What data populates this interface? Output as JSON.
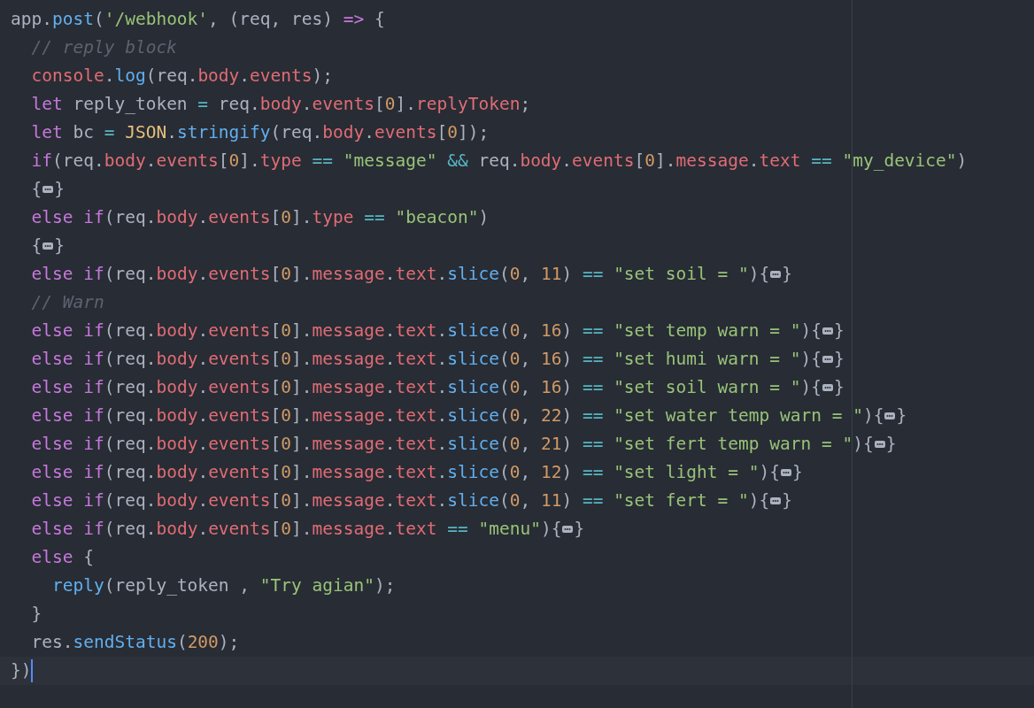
{
  "editor": {
    "lines": [
      {
        "tokens": [
          {
            "kind": "plain",
            "text": "app."
          },
          {
            "kind": "function",
            "text": "post"
          },
          {
            "kind": "plain",
            "text": "("
          },
          {
            "kind": "string",
            "text": "'/webhook'"
          },
          {
            "kind": "plain",
            "text": ", (req, res)"
          },
          {
            "kind": "keyword",
            "text": " =>"
          },
          {
            "kind": "plain",
            "text": " {"
          }
        ],
        "children": [
          {
            "tokens": [
              {
                "kind": "comment",
                "text": "// reply block"
              }
            ]
          },
          {
            "tokens": [
              {
                "kind": "property",
                "text": "console"
              },
              {
                "kind": "plain",
                "text": "."
              },
              {
                "kind": "function",
                "text": "log"
              },
              {
                "kind": "plain",
                "text": "(req."
              },
              {
                "kind": "property",
                "text": "body"
              },
              {
                "kind": "plain",
                "text": "."
              },
              {
                "kind": "property",
                "text": "events"
              },
              {
                "kind": "plain",
                "text": ");"
              }
            ]
          },
          {
            "tokens": [
              {
                "kind": "keyword",
                "text": "let"
              },
              {
                "kind": "plain",
                "text": " reply_token"
              },
              {
                "kind": "operator",
                "text": " ="
              },
              {
                "kind": "plain",
                "text": " req."
              },
              {
                "kind": "property",
                "text": "body"
              },
              {
                "kind": "plain",
                "text": "."
              },
              {
                "kind": "property",
                "text": "events"
              },
              {
                "kind": "plain",
                "text": "["
              },
              {
                "kind": "number",
                "text": "0"
              },
              {
                "kind": "plain",
                "text": "]."
              },
              {
                "kind": "property",
                "text": "replyToken"
              },
              {
                "kind": "plain",
                "text": ";"
              }
            ]
          },
          {
            "tokens": [
              {
                "kind": "keyword",
                "text": "let"
              },
              {
                "kind": "plain",
                "text": " bc"
              },
              {
                "kind": "operator",
                "text": " ="
              },
              {
                "kind": "class",
                "text": " JSON"
              },
              {
                "kind": "plain",
                "text": "."
              },
              {
                "kind": "function",
                "text": "stringify"
              },
              {
                "kind": "plain",
                "text": "(req."
              },
              {
                "kind": "property",
                "text": "body"
              },
              {
                "kind": "plain",
                "text": "."
              },
              {
                "kind": "property",
                "text": "events"
              },
              {
                "kind": "plain",
                "text": "["
              },
              {
                "kind": "number",
                "text": "0"
              },
              {
                "kind": "plain",
                "text": "]);"
              }
            ]
          },
          {
            "tokens": [
              {
                "kind": "keyword",
                "text": "if"
              },
              {
                "kind": "plain",
                "text": "(req."
              },
              {
                "kind": "property",
                "text": "body"
              },
              {
                "kind": "plain",
                "text": "."
              },
              {
                "kind": "property",
                "text": "events"
              },
              {
                "kind": "plain",
                "text": "["
              },
              {
                "kind": "number",
                "text": "0"
              },
              {
                "kind": "plain",
                "text": "]."
              },
              {
                "kind": "property",
                "text": "type"
              },
              {
                "kind": "operator",
                "text": " =="
              },
              {
                "kind": "string",
                "text": " \"message\""
              },
              {
                "kind": "operator",
                "text": " &&"
              },
              {
                "kind": "plain",
                "text": " req."
              },
              {
                "kind": "property",
                "text": "body"
              },
              {
                "kind": "plain",
                "text": "."
              },
              {
                "kind": "property",
                "text": "events"
              },
              {
                "kind": "plain",
                "text": "["
              },
              {
                "kind": "number",
                "text": "0"
              },
              {
                "kind": "plain",
                "text": "]."
              },
              {
                "kind": "property",
                "text": "message"
              },
              {
                "kind": "plain",
                "text": "."
              },
              {
                "kind": "property",
                "text": "text"
              },
              {
                "kind": "operator",
                "text": " =="
              },
              {
                "kind": "string",
                "text": " \"my_device\""
              },
              {
                "kind": "plain",
                "text": ")"
              }
            ]
          },
          {
            "tokens": [
              {
                "kind": "plain",
                "text": "{"
              },
              {
                "kind": "fold"
              },
              {
                "kind": "plain",
                "text": "}"
              }
            ]
          },
          {
            "tokens": [
              {
                "kind": "keyword",
                "text": "else"
              },
              {
                "kind": "keyword",
                "text": " if"
              },
              {
                "kind": "plain",
                "text": "(req."
              },
              {
                "kind": "property",
                "text": "body"
              },
              {
                "kind": "plain",
                "text": "."
              },
              {
                "kind": "property",
                "text": "events"
              },
              {
                "kind": "plain",
                "text": "["
              },
              {
                "kind": "number",
                "text": "0"
              },
              {
                "kind": "plain",
                "text": "]."
              },
              {
                "kind": "property",
                "text": "type"
              },
              {
                "kind": "operator",
                "text": " =="
              },
              {
                "kind": "string",
                "text": " \"beacon\""
              },
              {
                "kind": "plain",
                "text": ")"
              }
            ]
          },
          {
            "tokens": [
              {
                "kind": "plain",
                "text": "{"
              },
              {
                "kind": "fold"
              },
              {
                "kind": "plain",
                "text": "}"
              }
            ]
          },
          {
            "tokens": [
              {
                "kind": "keyword",
                "text": "else"
              },
              {
                "kind": "keyword",
                "text": " if"
              },
              {
                "kind": "plain",
                "text": "(req."
              },
              {
                "kind": "property",
                "text": "body"
              },
              {
                "kind": "plain",
                "text": "."
              },
              {
                "kind": "property",
                "text": "events"
              },
              {
                "kind": "plain",
                "text": "["
              },
              {
                "kind": "number",
                "text": "0"
              },
              {
                "kind": "plain",
                "text": "]."
              },
              {
                "kind": "property",
                "text": "message"
              },
              {
                "kind": "plain",
                "text": "."
              },
              {
                "kind": "property",
                "text": "text"
              },
              {
                "kind": "plain",
                "text": "."
              },
              {
                "kind": "function",
                "text": "slice"
              },
              {
                "kind": "plain",
                "text": "("
              },
              {
                "kind": "number",
                "text": "0"
              },
              {
                "kind": "plain",
                "text": ","
              },
              {
                "kind": "number",
                "text": " 11"
              },
              {
                "kind": "plain",
                "text": ")"
              },
              {
                "kind": "operator",
                "text": " =="
              },
              {
                "kind": "string",
                "text": " \"set soil = \""
              },
              {
                "kind": "plain",
                "text": "){"
              },
              {
                "kind": "fold"
              },
              {
                "kind": "plain",
                "text": "}"
              }
            ]
          },
          {
            "tokens": [
              {
                "kind": "comment",
                "text": "// Warn"
              }
            ]
          },
          {
            "tokens": [
              {
                "kind": "keyword",
                "text": "else"
              },
              {
                "kind": "keyword",
                "text": " if"
              },
              {
                "kind": "plain",
                "text": "(req."
              },
              {
                "kind": "property",
                "text": "body"
              },
              {
                "kind": "plain",
                "text": "."
              },
              {
                "kind": "property",
                "text": "events"
              },
              {
                "kind": "plain",
                "text": "["
              },
              {
                "kind": "number",
                "text": "0"
              },
              {
                "kind": "plain",
                "text": "]."
              },
              {
                "kind": "property",
                "text": "message"
              },
              {
                "kind": "plain",
                "text": "."
              },
              {
                "kind": "property",
                "text": "text"
              },
              {
                "kind": "plain",
                "text": "."
              },
              {
                "kind": "function",
                "text": "slice"
              },
              {
                "kind": "plain",
                "text": "("
              },
              {
                "kind": "number",
                "text": "0"
              },
              {
                "kind": "plain",
                "text": ","
              },
              {
                "kind": "number",
                "text": " 16"
              },
              {
                "kind": "plain",
                "text": ")"
              },
              {
                "kind": "operator",
                "text": " =="
              },
              {
                "kind": "string",
                "text": " \"set temp warn = \""
              },
              {
                "kind": "plain",
                "text": "){"
              },
              {
                "kind": "fold"
              },
              {
                "kind": "plain",
                "text": "}"
              }
            ]
          },
          {
            "tokens": [
              {
                "kind": "keyword",
                "text": "else"
              },
              {
                "kind": "keyword",
                "text": " if"
              },
              {
                "kind": "plain",
                "text": "(req."
              },
              {
                "kind": "property",
                "text": "body"
              },
              {
                "kind": "plain",
                "text": "."
              },
              {
                "kind": "property",
                "text": "events"
              },
              {
                "kind": "plain",
                "text": "["
              },
              {
                "kind": "number",
                "text": "0"
              },
              {
                "kind": "plain",
                "text": "]."
              },
              {
                "kind": "property",
                "text": "message"
              },
              {
                "kind": "plain",
                "text": "."
              },
              {
                "kind": "property",
                "text": "text"
              },
              {
                "kind": "plain",
                "text": "."
              },
              {
                "kind": "function",
                "text": "slice"
              },
              {
                "kind": "plain",
                "text": "("
              },
              {
                "kind": "number",
                "text": "0"
              },
              {
                "kind": "plain",
                "text": ","
              },
              {
                "kind": "number",
                "text": " 16"
              },
              {
                "kind": "plain",
                "text": ")"
              },
              {
                "kind": "operator",
                "text": " =="
              },
              {
                "kind": "string",
                "text": " \"set humi warn = \""
              },
              {
                "kind": "plain",
                "text": "){"
              },
              {
                "kind": "fold"
              },
              {
                "kind": "plain",
                "text": "}"
              }
            ]
          },
          {
            "tokens": [
              {
                "kind": "keyword",
                "text": "else"
              },
              {
                "kind": "keyword",
                "text": " if"
              },
              {
                "kind": "plain",
                "text": "(req."
              },
              {
                "kind": "property",
                "text": "body"
              },
              {
                "kind": "plain",
                "text": "."
              },
              {
                "kind": "property",
                "text": "events"
              },
              {
                "kind": "plain",
                "text": "["
              },
              {
                "kind": "number",
                "text": "0"
              },
              {
                "kind": "plain",
                "text": "]."
              },
              {
                "kind": "property",
                "text": "message"
              },
              {
                "kind": "plain",
                "text": "."
              },
              {
                "kind": "property",
                "text": "text"
              },
              {
                "kind": "plain",
                "text": "."
              },
              {
                "kind": "function",
                "text": "slice"
              },
              {
                "kind": "plain",
                "text": "("
              },
              {
                "kind": "number",
                "text": "0"
              },
              {
                "kind": "plain",
                "text": ","
              },
              {
                "kind": "number",
                "text": " 16"
              },
              {
                "kind": "plain",
                "text": ")"
              },
              {
                "kind": "operator",
                "text": " =="
              },
              {
                "kind": "string",
                "text": " \"set soil warn = \""
              },
              {
                "kind": "plain",
                "text": "){"
              },
              {
                "kind": "fold"
              },
              {
                "kind": "plain",
                "text": "}"
              }
            ]
          },
          {
            "tokens": [
              {
                "kind": "keyword",
                "text": "else"
              },
              {
                "kind": "keyword",
                "text": " if"
              },
              {
                "kind": "plain",
                "text": "(req."
              },
              {
                "kind": "property",
                "text": "body"
              },
              {
                "kind": "plain",
                "text": "."
              },
              {
                "kind": "property",
                "text": "events"
              },
              {
                "kind": "plain",
                "text": "["
              },
              {
                "kind": "number",
                "text": "0"
              },
              {
                "kind": "plain",
                "text": "]."
              },
              {
                "kind": "property",
                "text": "message"
              },
              {
                "kind": "plain",
                "text": "."
              },
              {
                "kind": "property",
                "text": "text"
              },
              {
                "kind": "plain",
                "text": "."
              },
              {
                "kind": "function",
                "text": "slice"
              },
              {
                "kind": "plain",
                "text": "("
              },
              {
                "kind": "number",
                "text": "0"
              },
              {
                "kind": "plain",
                "text": ","
              },
              {
                "kind": "number",
                "text": " 22"
              },
              {
                "kind": "plain",
                "text": ")"
              },
              {
                "kind": "operator",
                "text": " =="
              },
              {
                "kind": "string",
                "text": " \"set water temp warn = \""
              },
              {
                "kind": "plain",
                "text": "){"
              },
              {
                "kind": "fold"
              },
              {
                "kind": "plain",
                "text": "}"
              }
            ]
          },
          {
            "tokens": [
              {
                "kind": "keyword",
                "text": "else"
              },
              {
                "kind": "keyword",
                "text": " if"
              },
              {
                "kind": "plain",
                "text": "(req."
              },
              {
                "kind": "property",
                "text": "body"
              },
              {
                "kind": "plain",
                "text": "."
              },
              {
                "kind": "property",
                "text": "events"
              },
              {
                "kind": "plain",
                "text": "["
              },
              {
                "kind": "number",
                "text": "0"
              },
              {
                "kind": "plain",
                "text": "]."
              },
              {
                "kind": "property",
                "text": "message"
              },
              {
                "kind": "plain",
                "text": "."
              },
              {
                "kind": "property",
                "text": "text"
              },
              {
                "kind": "plain",
                "text": "."
              },
              {
                "kind": "function",
                "text": "slice"
              },
              {
                "kind": "plain",
                "text": "("
              },
              {
                "kind": "number",
                "text": "0"
              },
              {
                "kind": "plain",
                "text": ","
              },
              {
                "kind": "number",
                "text": " 21"
              },
              {
                "kind": "plain",
                "text": ")"
              },
              {
                "kind": "operator",
                "text": " =="
              },
              {
                "kind": "string",
                "text": " \"set fert temp warn = \""
              },
              {
                "kind": "plain",
                "text": "){"
              },
              {
                "kind": "fold"
              },
              {
                "kind": "plain",
                "text": "}"
              }
            ]
          },
          {
            "tokens": [
              {
                "kind": "keyword",
                "text": "else"
              },
              {
                "kind": "keyword",
                "text": " if"
              },
              {
                "kind": "plain",
                "text": "(req."
              },
              {
                "kind": "property",
                "text": "body"
              },
              {
                "kind": "plain",
                "text": "."
              },
              {
                "kind": "property",
                "text": "events"
              },
              {
                "kind": "plain",
                "text": "["
              },
              {
                "kind": "number",
                "text": "0"
              },
              {
                "kind": "plain",
                "text": "]."
              },
              {
                "kind": "property",
                "text": "message"
              },
              {
                "kind": "plain",
                "text": "."
              },
              {
                "kind": "property",
                "text": "text"
              },
              {
                "kind": "plain",
                "text": "."
              },
              {
                "kind": "function",
                "text": "slice"
              },
              {
                "kind": "plain",
                "text": "("
              },
              {
                "kind": "number",
                "text": "0"
              },
              {
                "kind": "plain",
                "text": ","
              },
              {
                "kind": "number",
                "text": " 12"
              },
              {
                "kind": "plain",
                "text": ")"
              },
              {
                "kind": "operator",
                "text": " =="
              },
              {
                "kind": "string",
                "text": " \"set light = \""
              },
              {
                "kind": "plain",
                "text": "){"
              },
              {
                "kind": "fold"
              },
              {
                "kind": "plain",
                "text": "}"
              }
            ]
          },
          {
            "tokens": [
              {
                "kind": "keyword",
                "text": "else"
              },
              {
                "kind": "keyword",
                "text": " if"
              },
              {
                "kind": "plain",
                "text": "(req."
              },
              {
                "kind": "property",
                "text": "body"
              },
              {
                "kind": "plain",
                "text": "."
              },
              {
                "kind": "property",
                "text": "events"
              },
              {
                "kind": "plain",
                "text": "["
              },
              {
                "kind": "number",
                "text": "0"
              },
              {
                "kind": "plain",
                "text": "]."
              },
              {
                "kind": "property",
                "text": "message"
              },
              {
                "kind": "plain",
                "text": "."
              },
              {
                "kind": "property",
                "text": "text"
              },
              {
                "kind": "plain",
                "text": "."
              },
              {
                "kind": "function",
                "text": "slice"
              },
              {
                "kind": "plain",
                "text": "("
              },
              {
                "kind": "number",
                "text": "0"
              },
              {
                "kind": "plain",
                "text": ","
              },
              {
                "kind": "number",
                "text": " 11"
              },
              {
                "kind": "plain",
                "text": ")"
              },
              {
                "kind": "operator",
                "text": " =="
              },
              {
                "kind": "string",
                "text": " \"set fert = \""
              },
              {
                "kind": "plain",
                "text": "){"
              },
              {
                "kind": "fold"
              },
              {
                "kind": "plain",
                "text": "}"
              }
            ]
          },
          {
            "tokens": [
              {
                "kind": "keyword",
                "text": "else"
              },
              {
                "kind": "keyword",
                "text": " if"
              },
              {
                "kind": "plain",
                "text": "(req."
              },
              {
                "kind": "property",
                "text": "body"
              },
              {
                "kind": "plain",
                "text": "."
              },
              {
                "kind": "property",
                "text": "events"
              },
              {
                "kind": "plain",
                "text": "["
              },
              {
                "kind": "number",
                "text": "0"
              },
              {
                "kind": "plain",
                "text": "]."
              },
              {
                "kind": "property",
                "text": "message"
              },
              {
                "kind": "plain",
                "text": "."
              },
              {
                "kind": "property",
                "text": "text"
              },
              {
                "kind": "operator",
                "text": " =="
              },
              {
                "kind": "string",
                "text": " \"menu\""
              },
              {
                "kind": "plain",
                "text": "){"
              },
              {
                "kind": "fold"
              },
              {
                "kind": "plain",
                "text": "}"
              }
            ]
          },
          {
            "tokens": [
              {
                "kind": "keyword",
                "text": "else"
              },
              {
                "kind": "plain",
                "text": " {"
              }
            ],
            "children": [
              {
                "tokens": [
                  {
                    "kind": "function",
                    "text": "reply"
                  },
                  {
                    "kind": "plain",
                    "text": "(reply_token ,"
                  },
                  {
                    "kind": "string",
                    "text": " \"Try agian\""
                  },
                  {
                    "kind": "plain",
                    "text": ");"
                  }
                ]
              }
            ]
          },
          {
            "tokens": [
              {
                "kind": "plain",
                "text": "}"
              }
            ]
          },
          {
            "tokens": [
              {
                "kind": "plain",
                "text": "res."
              },
              {
                "kind": "function",
                "text": "sendStatus"
              },
              {
                "kind": "plain",
                "text": "("
              },
              {
                "kind": "number",
                "text": "200"
              },
              {
                "kind": "plain",
                "text": ");"
              }
            ]
          }
        ]
      },
      {
        "tokens": [
          {
            "kind": "plain",
            "text": "})"
          }
        ],
        "current": true
      }
    ]
  }
}
